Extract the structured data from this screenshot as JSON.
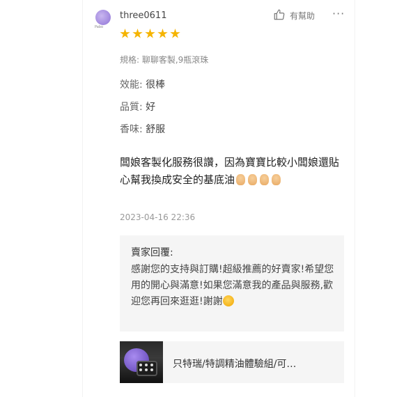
{
  "reviewer": {
    "name": "three0611",
    "avatar_caption": "Pabo"
  },
  "actions": {
    "helpful_label": "有幫助",
    "more_icon": "more-dots-icon",
    "helpful_icon": "thumbs-up-icon"
  },
  "rating": {
    "stars": 5,
    "max": 5,
    "color": "#f5b400"
  },
  "spec": "規格: 聊聊客製,9瓶滾珠",
  "attributes": [
    {
      "key": "效能:",
      "value": "很棒"
    },
    {
      "key": "品質:",
      "value": "好"
    },
    {
      "key": "香味:",
      "value": "舒服"
    }
  ],
  "review": {
    "text": "闆娘客製化服務很讚，因為寶寶比較小闆娘還貼心幫我換成安全的基底油",
    "emoji": "thumbs-up-emoji"
  },
  "date": "2023-04-16 22:36",
  "seller_reply": {
    "title": "賣家回覆:",
    "text": "感謝您的支持與訂購!超級推薦的好賣家!希望您用的開心與滿意!如果您滿意我的產品與服務,歡迎您再回來逛逛!謝謝",
    "emoji": "smile-emoji"
  },
  "product": {
    "name": "只特瑞/特調精油體驗組/可…"
  }
}
